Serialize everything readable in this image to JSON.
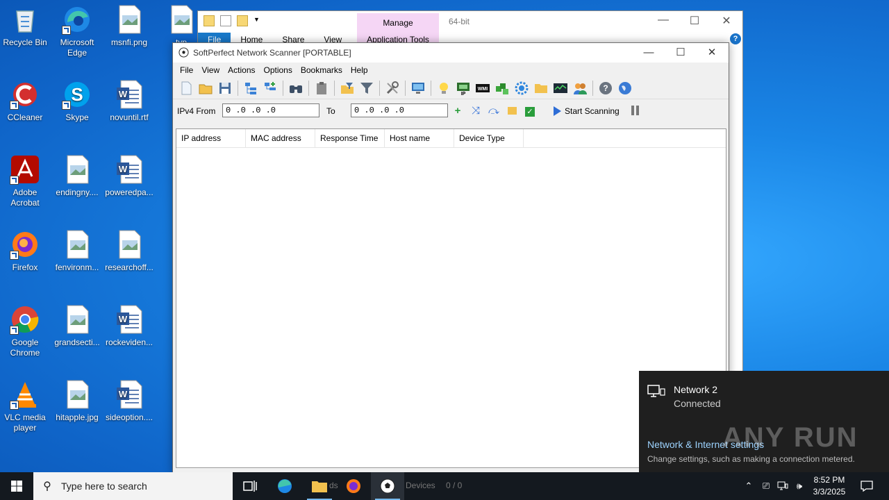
{
  "desktop": {
    "icons": [
      {
        "label": "Recycle Bin",
        "icon": "recycle-bin-icon"
      },
      {
        "label": "Microsoft Edge",
        "icon": "edge-icon"
      },
      {
        "label": "msnfi.png",
        "icon": "image-file-icon"
      },
      {
        "label": "typ",
        "icon": "image-file-icon"
      },
      {
        "label": "CCleaner",
        "icon": "ccleaner-icon"
      },
      {
        "label": "Skype",
        "icon": "skype-icon"
      },
      {
        "label": "novuntil.rtf",
        "icon": "word-doc-icon"
      },
      {
        "label": "Adobe Acrobat",
        "icon": "acrobat-icon"
      },
      {
        "label": "endingny....",
        "icon": "image-file-icon"
      },
      {
        "label": "poweredpa...",
        "icon": "word-doc-icon"
      },
      {
        "label": "Firefox",
        "icon": "firefox-icon"
      },
      {
        "label": "fenvironm...",
        "icon": "image-file-icon"
      },
      {
        "label": "researchoff...",
        "icon": "image-file-icon"
      },
      {
        "label": "Google Chrome",
        "icon": "chrome-icon"
      },
      {
        "label": "grandsecti...",
        "icon": "image-file-icon"
      },
      {
        "label": "rockeviden...",
        "icon": "word-doc-icon"
      },
      {
        "label": "VLC media player",
        "icon": "vlc-icon"
      },
      {
        "label": "hitapple.jpg",
        "icon": "image-file-icon"
      },
      {
        "label": "sideoption....",
        "icon": "word-doc-icon"
      }
    ]
  },
  "explorer": {
    "tabs": [
      "File",
      "Home",
      "Share",
      "View"
    ],
    "context_tab": "Manage",
    "context_group": "Application Tools",
    "title": "64-bit"
  },
  "scanner": {
    "title": "SoftPerfect Network Scanner [PORTABLE]",
    "menu": [
      "File",
      "View",
      "Actions",
      "Options",
      "Bookmarks",
      "Help"
    ],
    "ipv4_from_label": "IPv4 From",
    "ipv4_from_value": "0 .0 .0 .0",
    "to_label": "To",
    "ipv4_to_value": "0 .0 .0 .0",
    "start_label": "Start Scanning",
    "columns": [
      "IP address",
      "MAC address",
      "Response Time",
      "Host name",
      "Device Type"
    ]
  },
  "taskbar": {
    "search_placeholder": "Type here to search",
    "time": "8:52 PM",
    "date": "3/3/2025",
    "ghost_devices": "Devices",
    "ghost_count": "0 / 0",
    "ghost_ds": "ds"
  },
  "network_flyout": {
    "name": "Network 2",
    "status": "Connected",
    "settings_link": "Network & Internet settings",
    "settings_sub": "Change settings, such as making a connection metered."
  },
  "watermark": "ANY RUN"
}
